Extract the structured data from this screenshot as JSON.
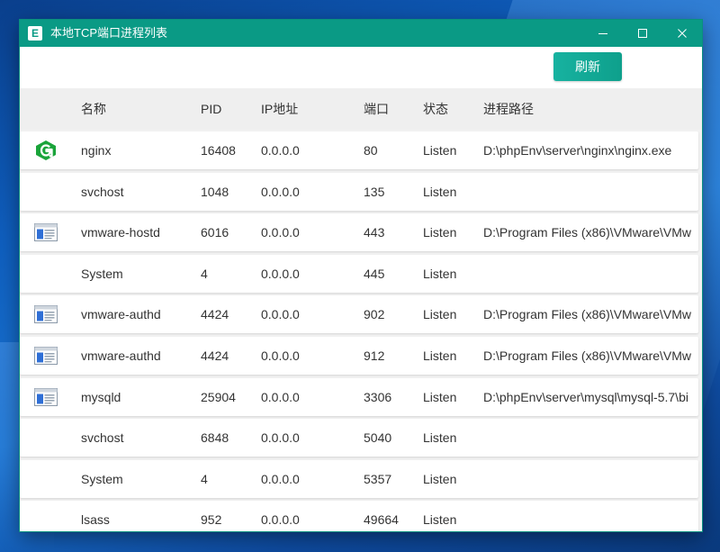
{
  "window": {
    "title": "本地TCP端口进程列表",
    "app_icon": "E",
    "controls": {
      "minimize": "minimize-icon",
      "maximize": "maximize-icon",
      "close": "close-icon"
    }
  },
  "toolbar": {
    "refresh_label": "刷新"
  },
  "colors": {
    "accent": "#0a9a85",
    "button": "#14aa97",
    "row_bg": "#ffffff",
    "table_bg": "#f2f2f2"
  },
  "table": {
    "headers": {
      "name": "名称",
      "pid": "PID",
      "ip": "IP地址",
      "port": "端口",
      "state": "状态",
      "path": "进程路径"
    },
    "rows": [
      {
        "icon": "nginx-icon",
        "name": "nginx",
        "pid": "16408",
        "ip": "0.0.0.0",
        "port": "80",
        "state": "Listen",
        "path": "D:\\phpEnv\\server\\nginx\\nginx.exe"
      },
      {
        "icon": "",
        "name": "svchost",
        "pid": "1048",
        "ip": "0.0.0.0",
        "port": "135",
        "state": "Listen",
        "path": ""
      },
      {
        "icon": "app-window-icon",
        "name": "vmware-hostd",
        "pid": "6016",
        "ip": "0.0.0.0",
        "port": "443",
        "state": "Listen",
        "path": "D:\\Program Files (x86)\\VMware\\VMw"
      },
      {
        "icon": "",
        "name": "System",
        "pid": "4",
        "ip": "0.0.0.0",
        "port": "445",
        "state": "Listen",
        "path": ""
      },
      {
        "icon": "app-window-icon",
        "name": "vmware-authd",
        "pid": "4424",
        "ip": "0.0.0.0",
        "port": "902",
        "state": "Listen",
        "path": "D:\\Program Files (x86)\\VMware\\VMw"
      },
      {
        "icon": "app-window-icon",
        "name": "vmware-authd",
        "pid": "4424",
        "ip": "0.0.0.0",
        "port": "912",
        "state": "Listen",
        "path": "D:\\Program Files (x86)\\VMware\\VMw"
      },
      {
        "icon": "app-window-icon",
        "name": "mysqld",
        "pid": "25904",
        "ip": "0.0.0.0",
        "port": "3306",
        "state": "Listen",
        "path": "D:\\phpEnv\\server\\mysql\\mysql-5.7\\bi"
      },
      {
        "icon": "",
        "name": "svchost",
        "pid": "6848",
        "ip": "0.0.0.0",
        "port": "5040",
        "state": "Listen",
        "path": ""
      },
      {
        "icon": "",
        "name": "System",
        "pid": "4",
        "ip": "0.0.0.0",
        "port": "5357",
        "state": "Listen",
        "path": ""
      },
      {
        "icon": "",
        "name": "lsass",
        "pid": "952",
        "ip": "0.0.0.0",
        "port": "49664",
        "state": "Listen",
        "path": ""
      }
    ]
  }
}
